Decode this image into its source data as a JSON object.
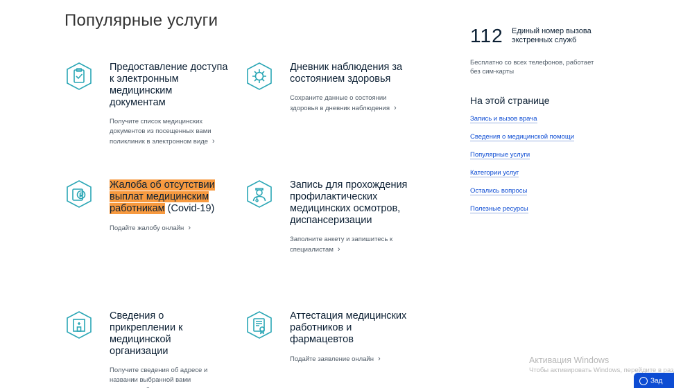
{
  "section": {
    "title": "Популярные услуги"
  },
  "cards": [
    {
      "title": "Предоставление доступа к электронным медицинским документам",
      "desc": "Получите список медицинских документов из посещенных вами поликлиник в электронном виде",
      "icon": "clipboard-check-icon"
    },
    {
      "title": "Дневник наблюдения за состоянием здоровья",
      "desc": "Сохраните данные о состоянии здоровья в дневник наблюдения",
      "icon": "virus-icon"
    },
    {
      "title_highlight": "Жалоба об отсутствии выплат медицинским работникам",
      "title_rest": " (Covid-19)",
      "desc": "Подайте жалобу онлайн",
      "icon": "money-document-icon"
    },
    {
      "title": "Запись для прохождения профилактических медицинских осмотров, диспансеризации",
      "desc": "Заполните анкету и запишитесь к специалистам",
      "icon": "doctor-icon"
    },
    {
      "title": "Сведения о прикреплении к медицинской организации",
      "desc": "Получите сведения об адресе и названии выбранной вами медицинской организации",
      "icon": "hospital-icon"
    },
    {
      "title": "Аттестация медицинских работников и фармацевтов",
      "desc": "Подайте заявление онлайн",
      "icon": "certificate-icon"
    }
  ],
  "emergency": {
    "number": "112",
    "caption": "Единый номер вызова экстренных служб",
    "note": "Бесплатно со всех телефонов, работает без сим-карты"
  },
  "toc": {
    "title": "На этой странице",
    "items": [
      "Запись и вызов врача",
      "Сведения о медицинской помощи",
      "Популярные услуги",
      "Категории услуг",
      "Остались вопросы",
      "Полезные ресурсы"
    ]
  },
  "watermark": {
    "title": "Активация Windows",
    "subtitle": "Чтобы активировать Windows, перейдите в раздел"
  },
  "help_button": {
    "label": "Зад"
  },
  "colors": {
    "icon_teal": "#2aa6b5",
    "highlight": "#f79a40",
    "link": "#0d4cd3"
  }
}
